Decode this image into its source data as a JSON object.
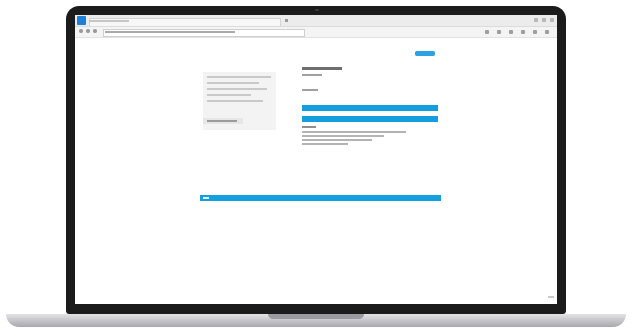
{
  "device": {
    "kind": "laptop"
  },
  "colors": {
    "accent_blue": "#159edd",
    "banner_blue": "#12a0e0",
    "bezel": "#1b1b1b",
    "sidebar_bg": "#f3f3f3"
  },
  "browser": {
    "icons": [
      "app-icon",
      "back-arrow-icon",
      "forward-arrow-icon",
      "refresh-icon",
      "star-icon",
      "menu-icon"
    ]
  }
}
